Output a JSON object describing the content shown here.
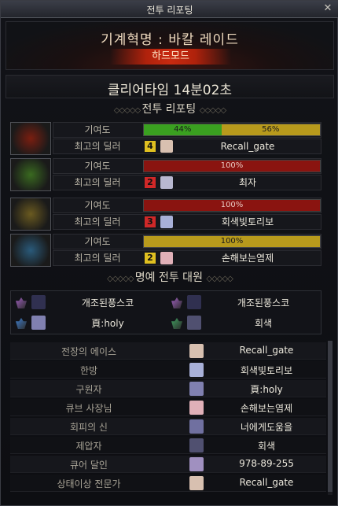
{
  "window": {
    "title": "전투 리포팅",
    "close_icon": "close-icon"
  },
  "header": {
    "raid_name": "기계혁명 : 바칼 레이드",
    "mode": "하드모드"
  },
  "clear_time": "클리어타임  14분02초",
  "battle_report": {
    "title": "전투 리포팅",
    "parties": [
      {
        "portrait_color": "#7a1e10",
        "contribution_label": "기여도",
        "dealer_label": "최고의 딜러",
        "contribution": [
          {
            "label": "44%",
            "fraction": 0.44,
            "color": "#3aa020"
          },
          {
            "label": "56%",
            "fraction": 0.56,
            "color": "#b89a1c"
          }
        ],
        "rank": "4",
        "rank_color": "#e0c020",
        "avatar_color": "#d8c0b0",
        "dealer_name": "Recall_gate"
      },
      {
        "portrait_color": "#3a6a20",
        "contribution_label": "기여도",
        "dealer_label": "최고의 딜러",
        "contribution": [
          {
            "label": "100%",
            "fraction": 1.0,
            "color": "#8a1410"
          }
        ],
        "rank": "2",
        "rank_color": "#d02828",
        "avatar_color": "#b8b8d0",
        "dealer_name": "최자"
      },
      {
        "portrait_color": "#6a5a20",
        "contribution_label": "기여도",
        "dealer_label": "최고의 딜러",
        "contribution": [
          {
            "label": "100%",
            "fraction": 1.0,
            "color": "#8a1410"
          }
        ],
        "rank": "3",
        "rank_color": "#d02828",
        "avatar_color": "#a8b0d8",
        "dealer_name": "회색빛토리보"
      },
      {
        "portrait_color": "#2a5a7a",
        "contribution_label": "기여도",
        "dealer_label": "최고의 딜러",
        "contribution": [
          {
            "label": "100%",
            "fraction": 1.0,
            "color": "#b89a1c"
          }
        ],
        "rank": "2",
        "rank_color": "#e0c020",
        "avatar_color": "#e0b0b8",
        "dealer_name": "손해보는염제"
      }
    ]
  },
  "honor_party": {
    "title": "명예 전투 대원",
    "members": [
      {
        "name": "개조된풍스코",
        "class_color": "#a060c0",
        "avatar_color": "#303050"
      },
      {
        "name": "개조된풍스코",
        "class_color": "#a060c0",
        "avatar_color": "#303050"
      },
      {
        "name": "頁:holy",
        "class_color": "#4080d0",
        "avatar_color": "#8080b0"
      },
      {
        "name": "회색",
        "class_color": "#40a060",
        "avatar_color": "#505070"
      }
    ]
  },
  "awards": [
    {
      "title": "전장의 에이스",
      "player": "Recall_gate",
      "avatar_color": "#d8c0b0"
    },
    {
      "title": "한방",
      "player": "회색빛토리보",
      "avatar_color": "#a8b0d8"
    },
    {
      "title": "구원자",
      "player": "頁:holy",
      "avatar_color": "#8080b0"
    },
    {
      "title": "큐브 사장님",
      "player": "손해보는염제",
      "avatar_color": "#e0b0b8"
    },
    {
      "title": "회피의 신",
      "player": "너에게도움을",
      "avatar_color": "#7070a0"
    },
    {
      "title": "제압자",
      "player": "회색",
      "avatar_color": "#505070"
    },
    {
      "title": "큐어 달인",
      "player": "978-89-255",
      "avatar_color": "#a090c0"
    },
    {
      "title": "상태이상 전문가",
      "player": "Recall_gate",
      "avatar_color": "#d8c0b0"
    }
  ]
}
